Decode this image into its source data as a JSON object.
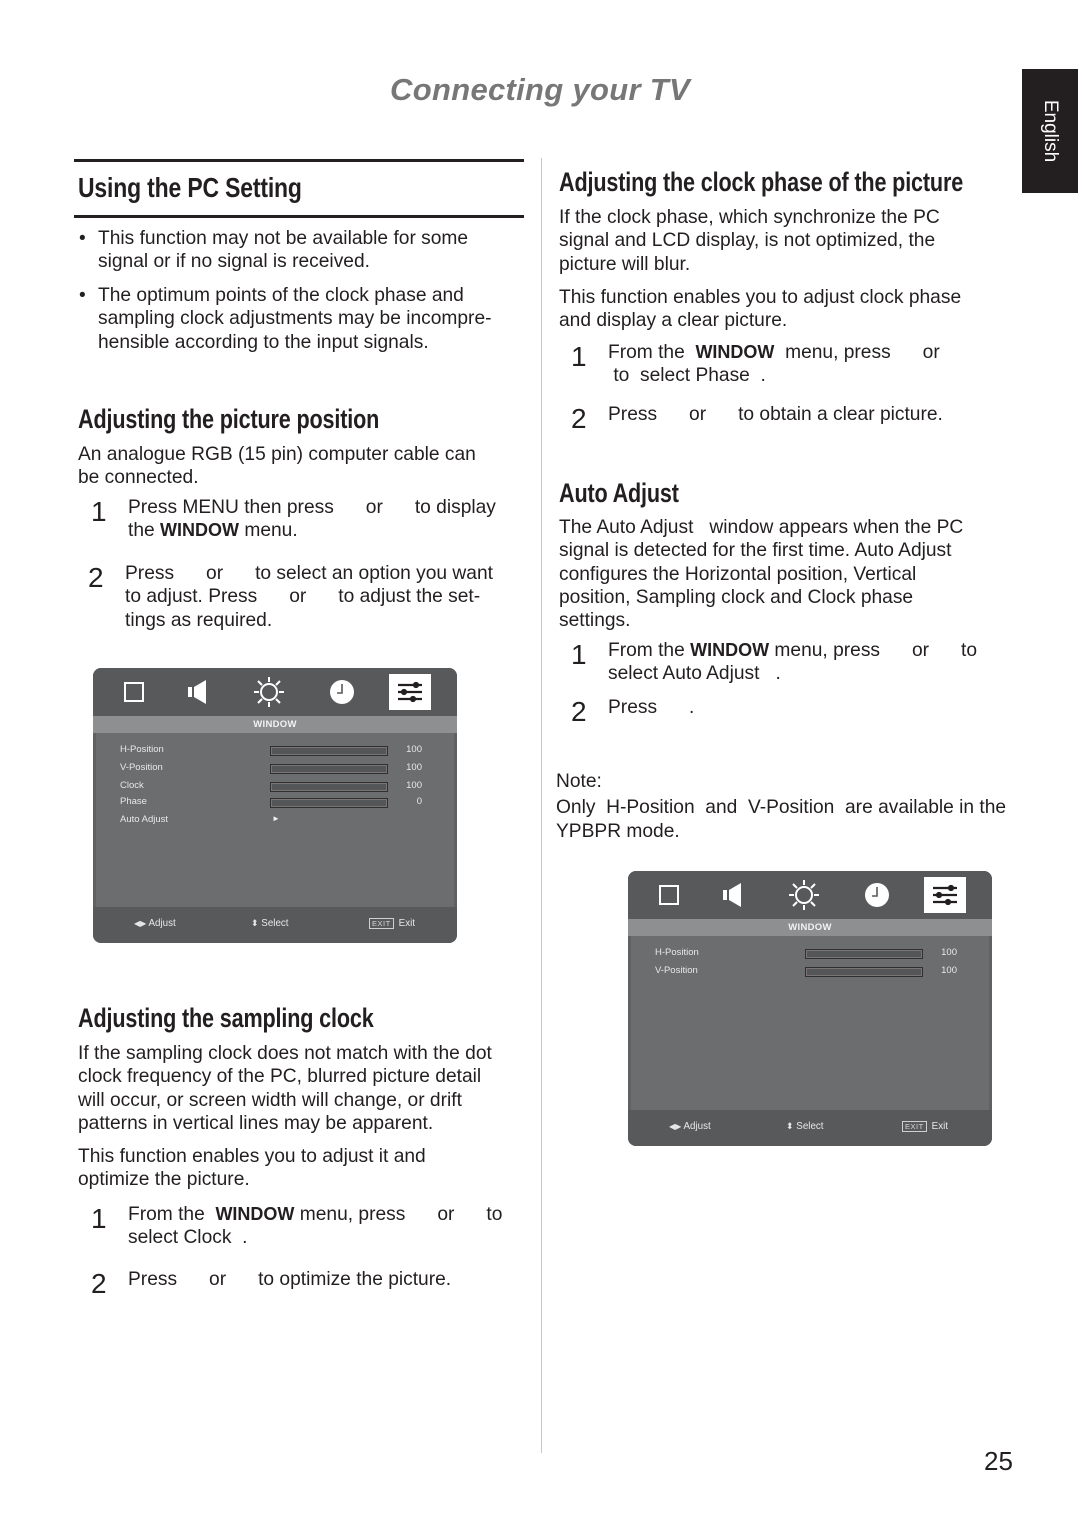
{
  "chapter_title": "Connecting your TV",
  "language_tab": "English",
  "page_number": "25",
  "left": {
    "section_title": "Using the PC Setting",
    "bullets": [
      [
        "This function may not be available for some",
        "signal or if no signal is received."
      ],
      [
        "The optimum points of the clock phase and",
        "sampling clock adjustments may be incompre-",
        "hensible according to the input signals."
      ]
    ],
    "picture_position": {
      "heading": "Adjusting the picture position",
      "intro": [
        "An analogue RGB (15 pin) computer cable can",
        "be connected."
      ],
      "steps": [
        {
          "num": "1",
          "line1": "Press MENU then press      or      to display",
          "line2_pre": "the ",
          "line2_bold": "WINDOW",
          "line2_post": " menu."
        },
        {
          "num": "2",
          "lines": [
            "Press      or      to select an option you want",
            "to adjust. Press      or      to adjust the set-",
            "tings as required."
          ]
        }
      ]
    },
    "sampling_clock": {
      "heading": "Adjusting the sampling clock",
      "intro": [
        "If the sampling clock does not match with the dot",
        "clock frequency of the PC, blurred picture detail",
        "will occur, or screen width will change, or drift",
        "patterns in vertical lines may be apparent."
      ],
      "intro2": [
        "This function enables you to adjust it and",
        "optimize the picture."
      ],
      "steps": [
        {
          "num": "1",
          "pre": "From the  ",
          "bold": "WINDOW",
          "post": " menu, press      or      to",
          "line2": "select Clock  ."
        },
        {
          "num": "2",
          "text": "Press      or      to optimize the picture."
        }
      ]
    }
  },
  "right": {
    "clock_phase": {
      "heading": "Adjusting the clock phase of the picture",
      "intro": [
        "If the clock phase, which synchronize the PC",
        "signal and LCD display, is not optimized, the",
        "picture will blur."
      ],
      "intro2": [
        "This function enables you to adjust clock phase",
        "and display a clear picture."
      ],
      "steps": [
        {
          "num": "1",
          "pre": "From the  ",
          "bold": "WINDOW",
          "post": "  menu, press      or",
          "line2": " to  select Phase  ."
        },
        {
          "num": "2",
          "text": "Press      or      to obtain a clear picture."
        }
      ]
    },
    "auto_adjust": {
      "heading": "Auto Adjust",
      "intro": [
        "The Auto Adjust   window appears when the PC",
        "signal is detected for the first time. Auto Adjust",
        "configures the Horizontal position, Vertical",
        "position, Sampling clock and Clock phase",
        "settings."
      ],
      "steps": [
        {
          "num": "1",
          "pre": "From the ",
          "bold": "WINDOW",
          "post": " menu, press      or      to",
          "line2": "select Auto Adjust   ."
        },
        {
          "num": "2",
          "text": "Press      ."
        }
      ]
    },
    "note": {
      "label": "Note:",
      "lines": [
        "Only  H-Position  and  V-Position  are available in the",
        "YPBPR mode."
      ]
    }
  },
  "osd_menus": [
    {
      "icons": [
        "picture-icon",
        "sound-icon",
        "brightness-icon",
        "clock-icon",
        "window-settings-icon"
      ],
      "active_icon": "window-settings-icon",
      "title": "WINDOW",
      "rows": [
        {
          "label": "H-Position",
          "value": "100",
          "level": 1.0
        },
        {
          "label": "V-Position",
          "value": "100",
          "level": 1.0
        },
        {
          "label": "Clock",
          "value": "100",
          "level": 1.0
        },
        {
          "label": "Phase",
          "value": "0",
          "level": 0.0
        },
        {
          "label": "Auto Adjust",
          "arrow": "►"
        }
      ],
      "footer": {
        "adjust": "Adjust",
        "select": "Select",
        "exit_key": "EXIT",
        "exit": "Exit"
      }
    },
    {
      "icons": [
        "picture-icon",
        "sound-icon",
        "brightness-icon",
        "clock-icon",
        "window-settings-icon"
      ],
      "active_icon": "window-settings-icon",
      "title": "WINDOW",
      "rows": [
        {
          "label": "H-Position",
          "value": "100",
          "level": 1.0
        },
        {
          "label": "V-Position",
          "value": "100",
          "level": 1.0
        }
      ],
      "footer": {
        "adjust": "Adjust",
        "select": "Select",
        "exit_key": "EXIT",
        "exit": "Exit"
      }
    }
  ]
}
